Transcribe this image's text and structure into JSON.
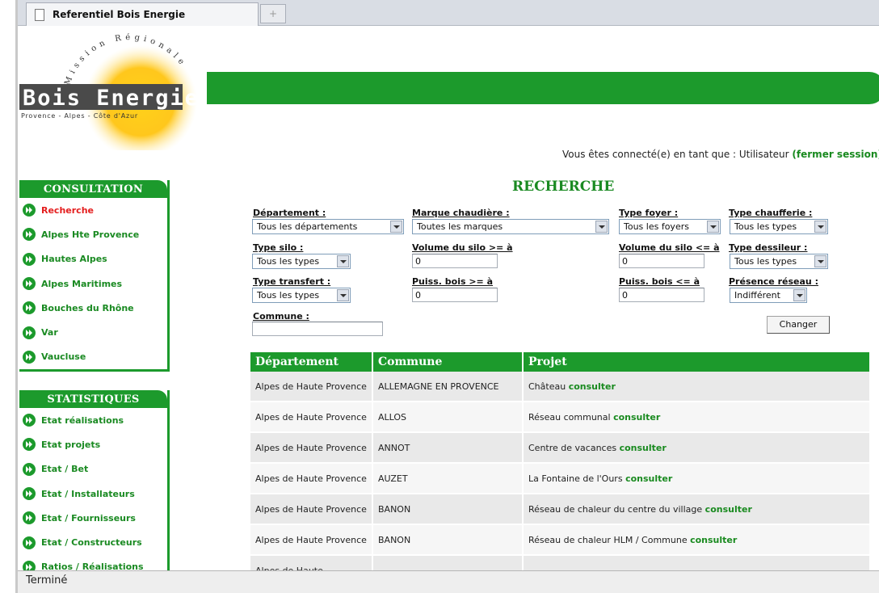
{
  "browser": {
    "tab_title": "Referentiel Bois Energie",
    "new_tab_glyph": "+",
    "status": "Terminé"
  },
  "header": {
    "logo_arc_text": "Mission Régionale",
    "logo_main": "Bois Energie",
    "logo_sub": "Provence - Alpes - Côte d'Azur",
    "connect_prefix": "Vous êtes connecté(e) en tant que : Utilisateur ",
    "logout_label": "(fermer session)"
  },
  "sidebar": {
    "consultation_title": "CONSULTATION",
    "consultation": [
      {
        "label": "Recherche"
      },
      {
        "label": "Alpes Hte Provence"
      },
      {
        "label": "Hautes Alpes"
      },
      {
        "label": "Alpes Maritimes"
      },
      {
        "label": "Bouches du Rhône"
      },
      {
        "label": "Var"
      },
      {
        "label": "Vaucluse"
      }
    ],
    "statistiques_title": "STATISTIQUES",
    "statistiques": [
      {
        "label": "Etat réalisations"
      },
      {
        "label": "Etat projets"
      },
      {
        "label": "Etat / Bet"
      },
      {
        "label": "Etat / Installateurs"
      },
      {
        "label": "Etat / Fournisseurs"
      },
      {
        "label": "Etat / Constructeurs"
      },
      {
        "label": "Ratios / Réalisations"
      }
    ]
  },
  "search": {
    "title": "RECHERCHE",
    "departement": {
      "label": "Département :",
      "value": "Tous les départements"
    },
    "marque": {
      "label": "Marque chaudière :",
      "value": "Toutes les marques"
    },
    "type_foyer": {
      "label": "Type foyer :",
      "value": "Tous les foyers"
    },
    "type_chaufferie": {
      "label": "Type chaufferie :",
      "value": "Tous les types"
    },
    "type_silo": {
      "label": "Type silo :",
      "value": "Tous les types"
    },
    "volume_min": {
      "label": "Volume du silo >= à",
      "value": "0"
    },
    "volume_max": {
      "label": "Volume du silo <= à",
      "value": "0"
    },
    "type_dessileur": {
      "label": "Type dessileur :",
      "value": "Tous les types"
    },
    "type_transfert": {
      "label": "Type transfert :",
      "value": "Tous les types"
    },
    "puiss_min": {
      "label": "Puiss. bois >= à",
      "value": "0"
    },
    "puiss_max": {
      "label": "Puiss. bois <= à",
      "value": "0"
    },
    "presence_reseau": {
      "label": "Présence réseau :",
      "value": "Indifférent"
    },
    "commune": {
      "label": "Commune :",
      "value": ""
    },
    "submit_label": "Changer"
  },
  "results": {
    "columns": [
      "Département",
      "Commune",
      "Projet"
    ],
    "link_label": "consulter",
    "rows": [
      {
        "departement": "Alpes de Haute Provence",
        "commune": "ALLEMAGNE EN PROVENCE",
        "projet": "Château "
      },
      {
        "departement": "Alpes de Haute Provence",
        "commune": "ALLOS",
        "projet": "Réseau communal "
      },
      {
        "departement": "Alpes de Haute Provence",
        "commune": "ANNOT",
        "projet": "Centre de vacances "
      },
      {
        "departement": "Alpes de Haute Provence",
        "commune": "AUZET",
        "projet": "La Fontaine de l'Ours "
      },
      {
        "departement": "Alpes de Haute Provence",
        "commune": "BANON",
        "projet": "Réseau de chaleur du centre du village "
      },
      {
        "departement": "Alpes de Haute Provence",
        "commune": "BANON",
        "projet": "Réseau de chaleur HLM / Commune "
      },
      {
        "departement": "Alpes de Haute",
        "commune": "",
        "projet": ""
      }
    ]
  },
  "colors": {
    "brand_green": "#1c9a2c",
    "link_green": "#198a1f",
    "active_red": "#e41e1e"
  }
}
